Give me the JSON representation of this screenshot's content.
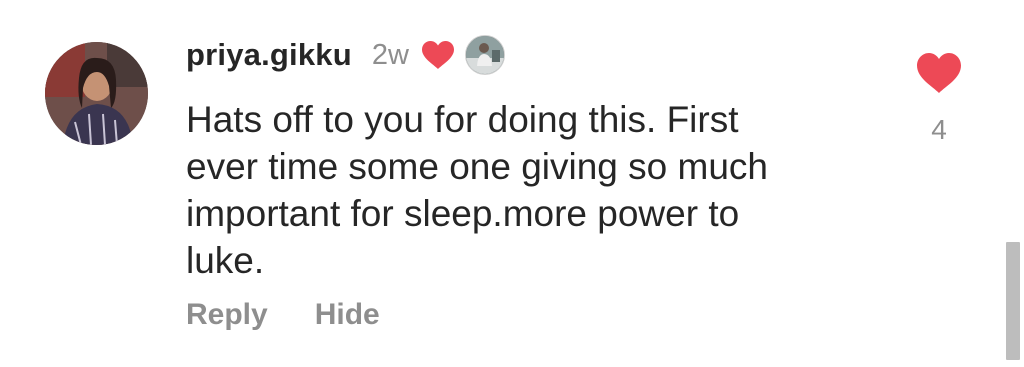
{
  "comment": {
    "username": "priya.gikku",
    "time_ago": "2w",
    "text": "Hats off to you for doing this. First\never time some one giving so much\nimportant for sleep.more power to\nluke.",
    "like_count": "4",
    "actions": {
      "reply_label": "Reply",
      "hide_label": "Hide"
    }
  },
  "icons": {
    "creator_liked": "heart-icon",
    "like": "heart-icon"
  },
  "colors": {
    "heart": "#ed4956",
    "username": "#262626",
    "secondary_text": "#8e8e8e",
    "scrollbar": "#bdbdbd"
  }
}
